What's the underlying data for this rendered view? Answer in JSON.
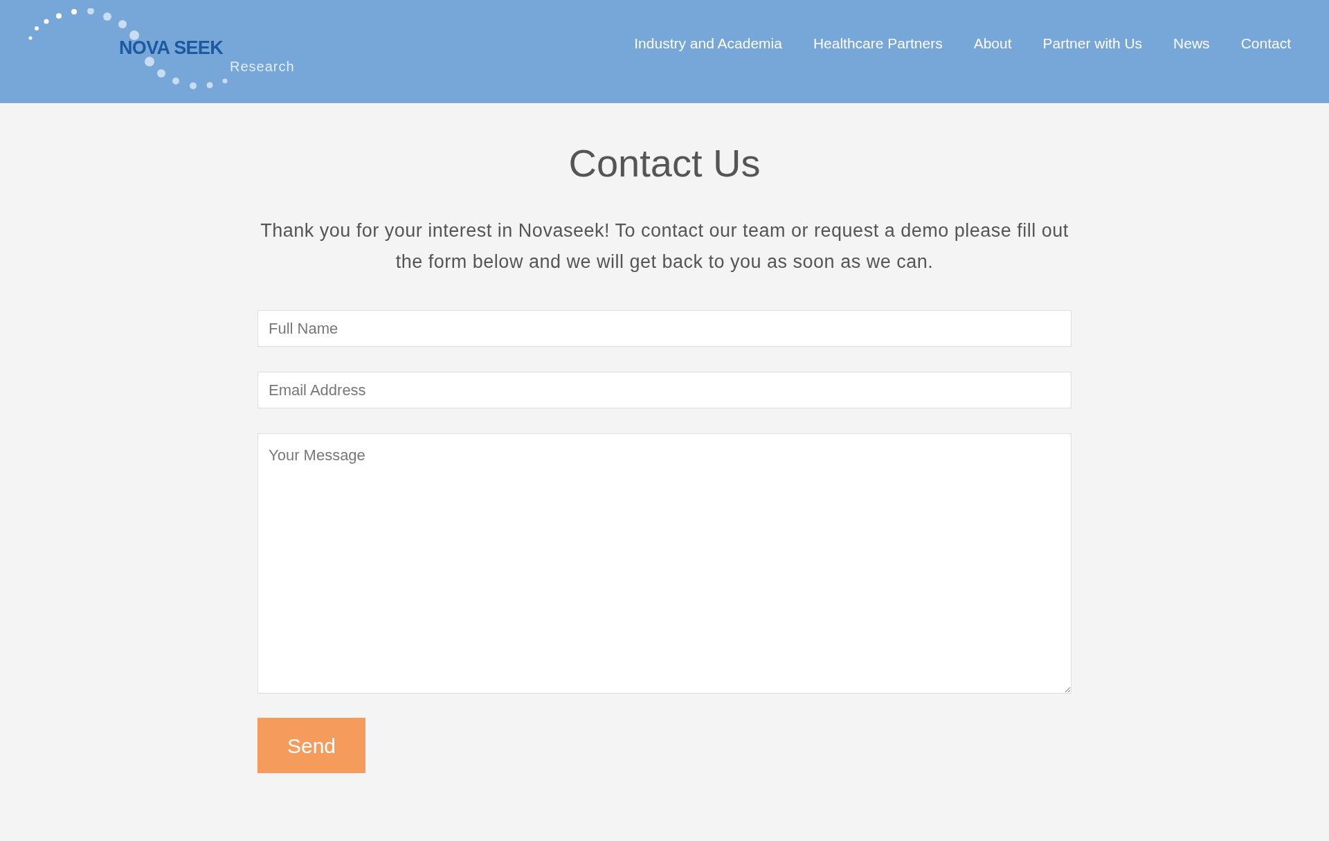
{
  "header": {
    "logo": {
      "name": "NOVA SEEK",
      "tagline": "Research"
    },
    "nav": [
      {
        "label": "Industry and Academia",
        "selected": false
      },
      {
        "label": "Healthcare Partners",
        "selected": false
      },
      {
        "label": "About",
        "selected": false
      },
      {
        "label": "Partner with Us",
        "selected": false
      },
      {
        "label": "News",
        "selected": false
      },
      {
        "label": "Contact",
        "selected": false
      }
    ]
  },
  "title": "Contact Us",
  "intro": "Thank you for your interest in Novaseek! To contact our team or request a demo please fill out the form below and we will get back to you as soon as we can.",
  "form": {
    "fields": [
      {
        "kind": "text",
        "placeholder": "Full Name"
      },
      {
        "kind": "text",
        "placeholder": "Email Address"
      },
      {
        "kind": "textarea",
        "placeholder": "Your Message"
      }
    ],
    "submit": "Send"
  }
}
